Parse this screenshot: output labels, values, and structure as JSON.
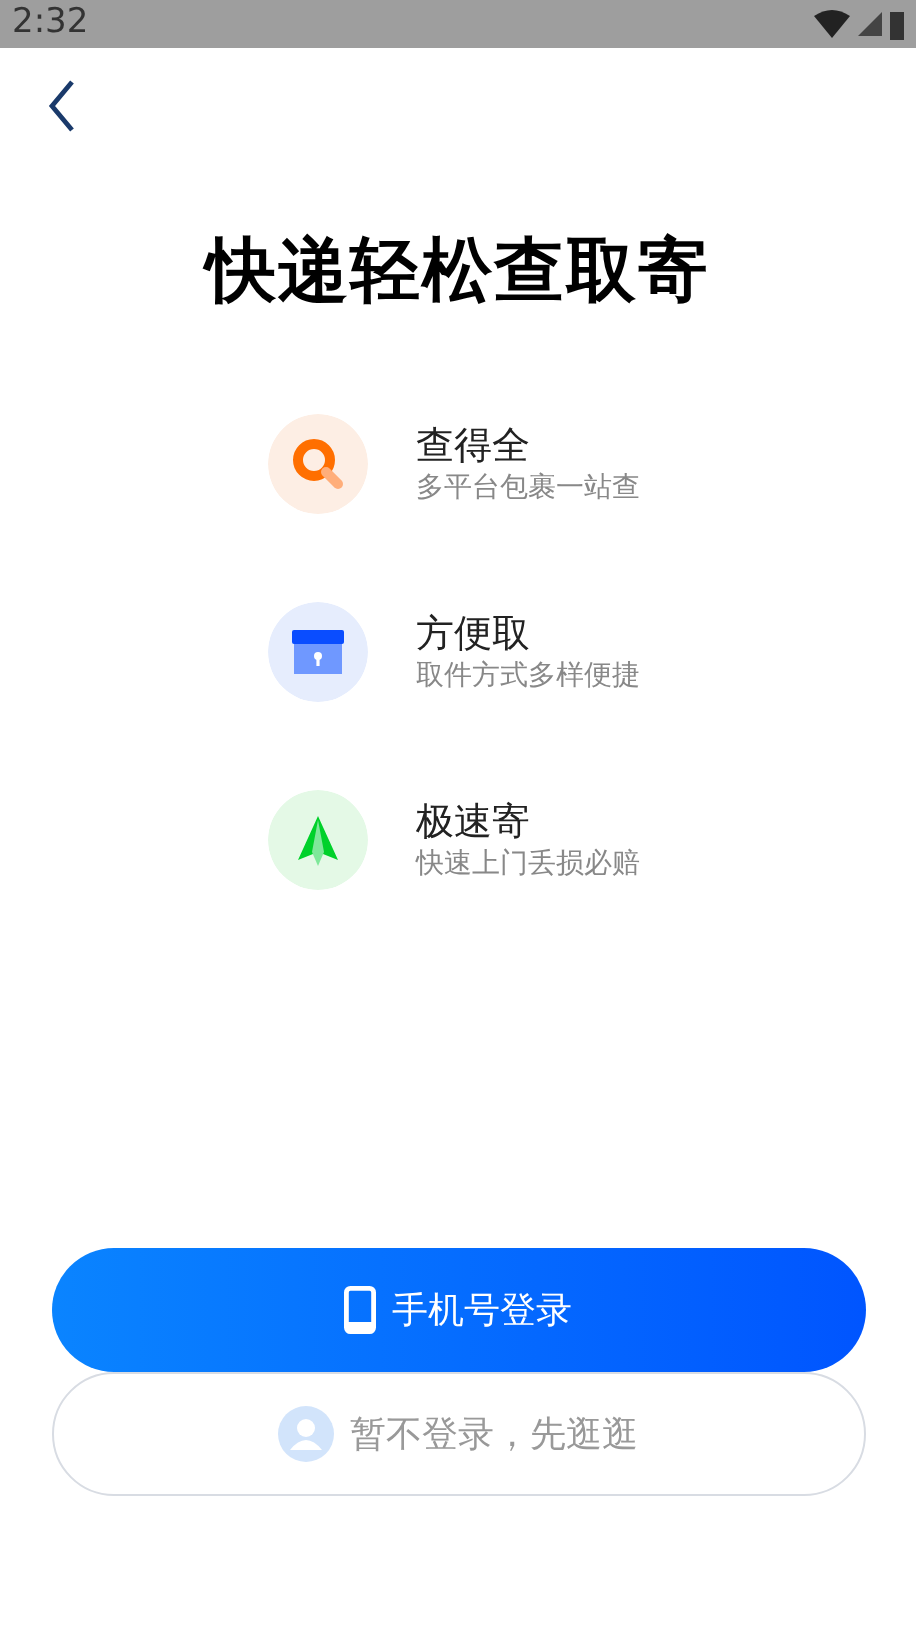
{
  "status_bar": {
    "time": "2:32"
  },
  "title": "快递轻松查取寄",
  "features": [
    {
      "kind": "search",
      "title": "查得全",
      "subtitle": "多平台包裹一站查"
    },
    {
      "kind": "box",
      "title": "方便取",
      "subtitle": "取件方式多样便捷"
    },
    {
      "kind": "plane",
      "title": "极速寄",
      "subtitle": "快速上门丢损必赔"
    }
  ],
  "primary_button": {
    "label": "手机号登录"
  },
  "secondary_button": {
    "label": "暂不登录，先逛逛"
  }
}
